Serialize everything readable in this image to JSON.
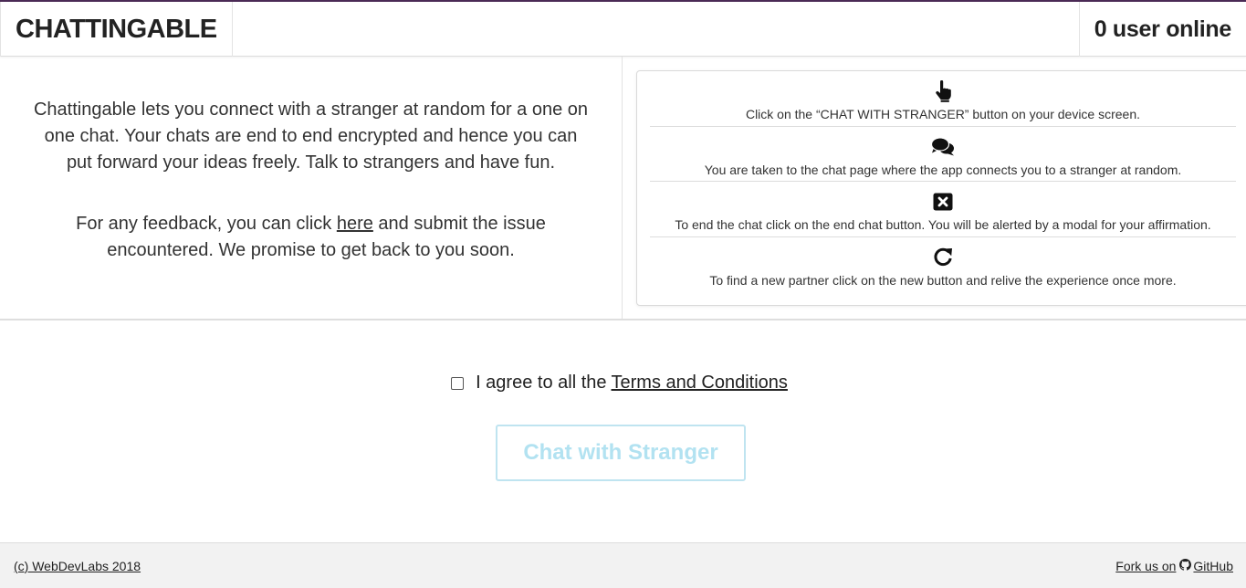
{
  "header": {
    "brand": "CHATTINGABLE",
    "online_status": "0 user online"
  },
  "about": {
    "intro": "Chattingable lets you connect with a stranger at random for a one on one chat. Your chats are end to end encrypted and hence you can put forward your ideas freely. Talk to strangers and have fun.",
    "feedback_before": "For any feedback, you can click ",
    "feedback_link": "here",
    "feedback_after": " and submit the issue encountered. We promise to get back to you soon."
  },
  "steps": [
    {
      "icon": "hand-pointer-icon",
      "text": "Click on the “CHAT WITH STRANGER” button on your device screen."
    },
    {
      "icon": "comments-icon",
      "text": "You are taken to the chat page where the app connects you to a stranger at random."
    },
    {
      "icon": "close-box-icon",
      "text": "To end the chat click on the end chat button. You will be alerted by a modal for your affirmation."
    },
    {
      "icon": "refresh-icon",
      "text": "To find a new partner click on the new button and relive the experience once more."
    }
  ],
  "consent": {
    "checked": false,
    "label": "I agree to all the",
    "link": "Terms and Conditions"
  },
  "chat_button": "Chat with Stranger",
  "footer": {
    "copyright": "(c) WebDevLabs 2018",
    "fork_prefix": "Fork us on",
    "fork_site": "GitHub"
  },
  "colors": {
    "header_accent": "#4a2a55",
    "button_disabled_text": "#b2e2f1",
    "button_disabled_border": "#bfe4f0",
    "footer_bg": "#f2f2f2"
  }
}
